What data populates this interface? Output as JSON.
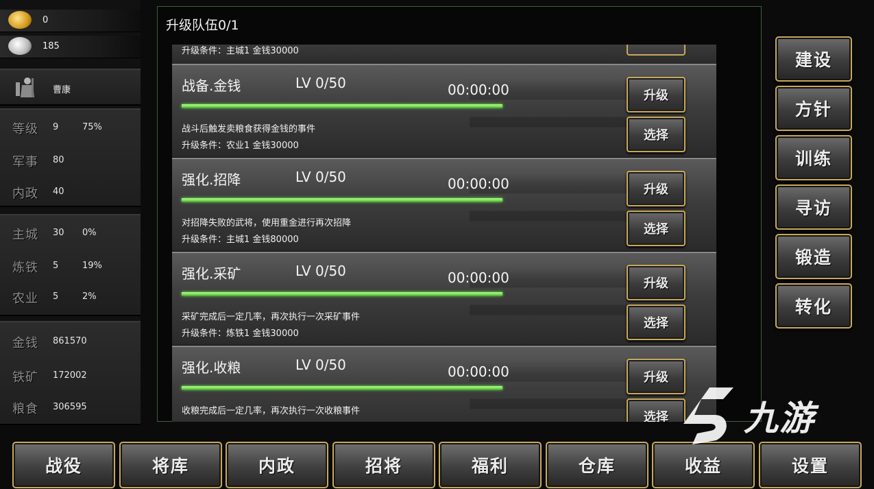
{
  "sidebar": {
    "gold": "0",
    "silver": "185",
    "general": {
      "name": "曹康"
    },
    "stats": [
      {
        "label": "等级",
        "value": "9",
        "extra": "75%"
      },
      {
        "label": "军事",
        "value": "80",
        "extra": ""
      },
      {
        "label": "内政",
        "value": "40",
        "extra": ""
      }
    ],
    "city": [
      {
        "label": "主城",
        "value": "30",
        "extra": "0%"
      },
      {
        "label": "炼铁",
        "value": "5",
        "extra": "19%"
      },
      {
        "label": "农业",
        "value": "5",
        "extra": "2%"
      }
    ],
    "resources": [
      {
        "label": "金钱",
        "value": "861570"
      },
      {
        "label": "铁矿",
        "value": "172002"
      },
      {
        "label": "粮食",
        "value": "306595"
      }
    ]
  },
  "dialog": {
    "title": "升级队伍0/1",
    "top_partial_condition": "升级条件：主城1 金钱30000",
    "cards": [
      {
        "name": "战备.金钱",
        "level": "LV 0/50",
        "time": "00:00:00",
        "progress": 1.0,
        "desc": "战斗后触发卖粮食获得金钱的事件",
        "condition": "升级条件：农业1 金钱30000",
        "upgrade_label": "升级",
        "select_label": "选择"
      },
      {
        "name": "强化.招降",
        "level": "LV 0/50",
        "time": "00:00:00",
        "progress": 1.0,
        "desc": "对招降失败的武将，使用重金进行再次招降",
        "condition": "升级条件：主城1 金钱80000",
        "upgrade_label": "升级",
        "select_label": "选择"
      },
      {
        "name": "强化.采矿",
        "level": "LV 0/50",
        "time": "00:00:00",
        "progress": 1.0,
        "desc": "采矿完成后一定几率，再次执行一次采矿事件",
        "condition": "升级条件：炼铁1 金钱30000",
        "upgrade_label": "升级",
        "select_label": "选择"
      },
      {
        "name": "强化.收粮",
        "level": "LV 0/50",
        "time": "00:00:00",
        "progress": 1.0,
        "desc": "收粮完成后一定几率，再次执行一次收粮事件",
        "condition": "",
        "upgrade_label": "升级",
        "select_label": "选择"
      }
    ]
  },
  "right_menu": [
    "建设",
    "方针",
    "训练",
    "寻访",
    "锻造",
    "转化"
  ],
  "bottom_nav": [
    "战役",
    "将库",
    "内政",
    "招将",
    "福利",
    "仓库",
    "收益",
    "设置"
  ],
  "watermark": {
    "text": "九游"
  },
  "colors": {
    "progress": "#55c23a",
    "border_gold": "#c9a85d",
    "dialog_border": "#3c5f3c"
  }
}
